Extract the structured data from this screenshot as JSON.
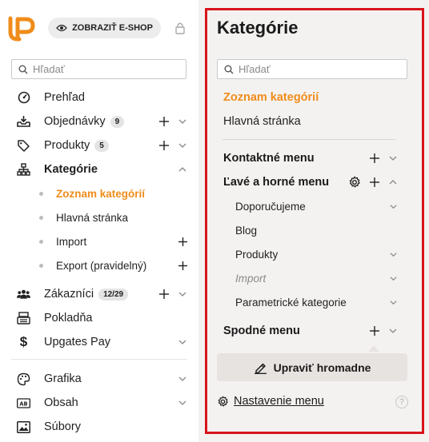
{
  "header": {
    "eshop_button": "ZOBRAZIŤ E-SHOP"
  },
  "sidebar": {
    "search_placeholder": "Hľadať",
    "items": [
      {
        "label": "Prehľad",
        "icon": "speedometer-icon"
      },
      {
        "label": "Objednávky",
        "badge": "9",
        "icon": "inbox-download-icon"
      },
      {
        "label": "Produkty",
        "badge": "5",
        "icon": "tag-icon"
      },
      {
        "label": "Kategórie",
        "icon": "sitemap-icon"
      },
      {
        "label": "Zákazníci",
        "badge": "12/29",
        "icon": "users-icon"
      },
      {
        "label": "Pokladňa",
        "icon": "cash-register-icon"
      },
      {
        "label": "Upgates Pay",
        "icon": "dollar-icon"
      },
      {
        "label": "Grafika",
        "icon": "palette-icon"
      },
      {
        "label": "Obsah",
        "icon": "ab-text-icon"
      },
      {
        "label": "Súbory",
        "icon": "image-icon"
      }
    ],
    "category_subitems": [
      {
        "label": "Zoznam kategórií"
      },
      {
        "label": "Hlavná stránka"
      },
      {
        "label": "Import"
      },
      {
        "label": "Export (pravidelný)"
      }
    ]
  },
  "panel": {
    "title": "Kategórie",
    "search_placeholder": "Hľadať",
    "links": [
      "Zoznam kategórií",
      "Hlavná stránka"
    ],
    "menus": {
      "contact": "Kontaktné menu",
      "left_top": "Ľavé a horné menu",
      "bottom": "Spodné menu"
    },
    "left_top_items": [
      "Doporučujeme",
      "Blog",
      "Produkty",
      "Import",
      "Parametrické kategorie"
    ],
    "bulk_edit_button": "Upraviť hromadne",
    "settings_link": "Nastavenie menu",
    "help": "?"
  },
  "colors": {
    "accent": "#f08c1a",
    "frame": "#d9141b",
    "panel_bg": "#f4f2f1"
  }
}
